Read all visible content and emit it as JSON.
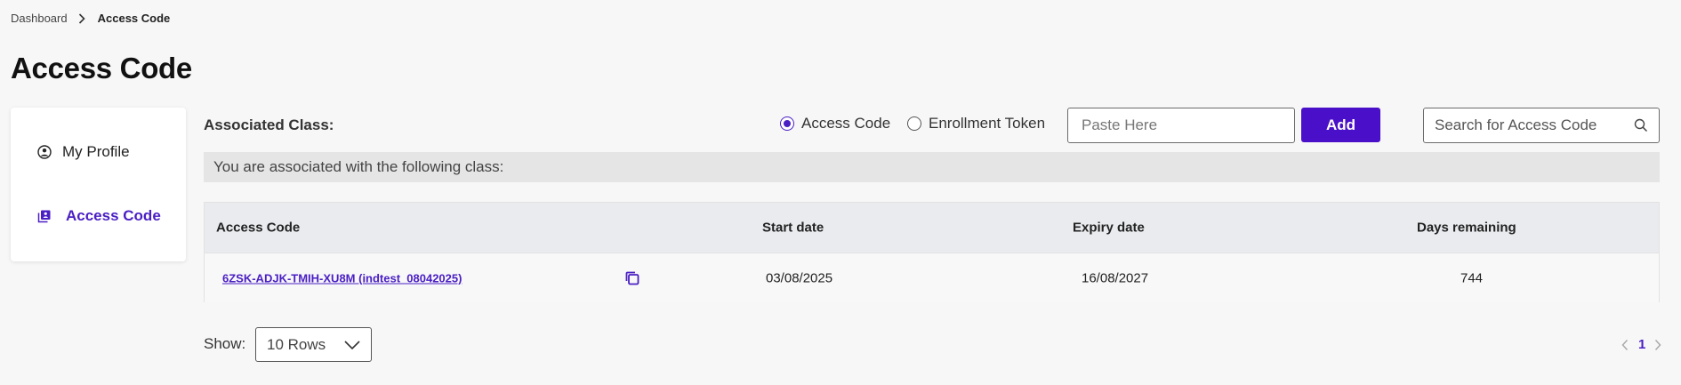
{
  "breadcrumb": {
    "home": "Dashboard",
    "current": "Access Code"
  },
  "page": {
    "title": "Access Code"
  },
  "sidebar": {
    "items": [
      {
        "label": "My Profile",
        "icon": "user-circle-icon",
        "active": false
      },
      {
        "label": "Access Code",
        "icon": "access-card-icon",
        "active": true
      }
    ]
  },
  "toolbar": {
    "associated_label": "Associated Class:",
    "radio_options": [
      {
        "label": "Access Code",
        "checked": true
      },
      {
        "label": "Enrollment Token",
        "checked": false
      }
    ],
    "paste_placeholder": "Paste Here",
    "add_label": "Add",
    "search_placeholder": "Search for Access Code"
  },
  "info_bar": {
    "text": "You are associated with the following class:"
  },
  "table": {
    "headers": [
      "Access Code",
      "Start date",
      "Expiry date",
      "Days remaining"
    ],
    "rows": [
      {
        "access_code": "6ZSK-ADJK-TMIH-XU8M (indtest_08042025)",
        "start_date": "03/08/2025",
        "expiry_date": "16/08/2027",
        "days_remaining": "744"
      }
    ]
  },
  "pagination": {
    "show_label": "Show:",
    "rows_option": "10 Rows",
    "current_page": "1"
  },
  "colors": {
    "accent": "#4a10c9",
    "background": "#f7f7f7",
    "table_header": "#e9ebee",
    "info_bar": "#e5e5e5"
  }
}
